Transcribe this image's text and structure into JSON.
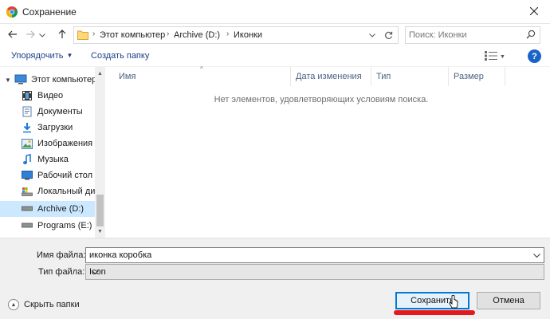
{
  "window": {
    "title": "Сохранение",
    "colors": {
      "accent": "#0078d7",
      "selection": "#cce8ff",
      "link": "#1c3f86",
      "help": "#1a64c7",
      "highlight": "#e2191d"
    }
  },
  "address_bar": {
    "crumbs": [
      "Этот компьютер",
      "Archive (D:)",
      "Иконки"
    ],
    "search_placeholder": "Поиск: Иконки"
  },
  "toolbar": {
    "organize_label": "Упорядочить",
    "new_folder_label": "Создать папку"
  },
  "nav_pane": {
    "items": [
      {
        "label": "Этот компьютер",
        "icon": "computer-icon"
      },
      {
        "label": "Видео",
        "icon": "video-icon"
      },
      {
        "label": "Документы",
        "icon": "documents-icon"
      },
      {
        "label": "Загрузки",
        "icon": "download-icon"
      },
      {
        "label": "Изображения",
        "icon": "pictures-icon"
      },
      {
        "label": "Музыка",
        "icon": "music-icon"
      },
      {
        "label": "Рабочий стол",
        "icon": "desktop-icon"
      },
      {
        "label": "Локальный дис",
        "icon": "drive-icon"
      },
      {
        "label": "Archive (D:)",
        "icon": "drive-icon",
        "selected": true
      },
      {
        "label": "Programs (E:)",
        "icon": "drive-icon"
      }
    ]
  },
  "file_list": {
    "columns": [
      "Имя",
      "Дата изменения",
      "Тип",
      "Размер"
    ],
    "empty_message": "Нет элементов, удовлетворяющих условиям поиска."
  },
  "form": {
    "filename_label": "Имя файла:",
    "filename_value": "иконка коробка",
    "filetype_label": "Тип файла:",
    "filetype_value": "Icon",
    "hide_folders_label": "Скрыть папки",
    "save_label": "Сохранить",
    "cancel_label": "Отмена"
  }
}
